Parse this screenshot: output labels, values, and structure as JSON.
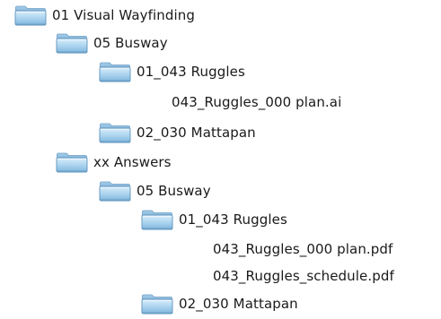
{
  "tree": {
    "items": [
      {
        "label": "01 Visual Wayfinding",
        "icon": "folder-icon"
      },
      {
        "label": "05 Busway",
        "icon": "folder-icon"
      },
      {
        "label": "01_043 Ruggles",
        "icon": "folder-icon"
      },
      {
        "label": "043_Ruggles_000 plan.ai",
        "icon": ""
      },
      {
        "label": "02_030 Mattapan",
        "icon": "folder-icon"
      },
      {
        "label": "xx Answers",
        "icon": "folder-icon"
      },
      {
        "label": "05 Busway",
        "icon": "folder-icon"
      },
      {
        "label": "01_043 Ruggles",
        "icon": "folder-icon"
      },
      {
        "label": "043_Ruggles_000 plan.pdf",
        "icon": ""
      },
      {
        "label": "043_Ruggles_schedule.pdf",
        "icon": ""
      },
      {
        "label": "02_030 Mattapan",
        "icon": "folder-icon"
      }
    ],
    "colors": {
      "folder_light": "#cfe6f6",
      "folder_mid": "#9fcbe8",
      "folder_dark": "#6fa7cf",
      "folder_edge": "#5a8fb8",
      "text": "#1a1a1a"
    }
  }
}
